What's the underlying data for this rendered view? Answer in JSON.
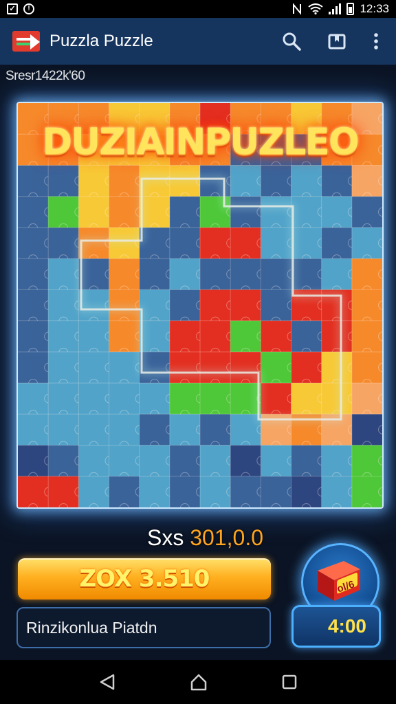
{
  "status_bar": {
    "time": "12:33",
    "left_icons": [
      "checkbox-icon",
      "info-circle-icon"
    ],
    "right_icons": [
      "nfc-icon",
      "wifi-icon",
      "signal-icon",
      "battery-icon"
    ]
  },
  "app_bar": {
    "title": "Puzzla Puzzle",
    "actions": [
      "search-icon",
      "bookmark-icon",
      "more-vert-icon"
    ]
  },
  "score_top": "Sresr1422k'60",
  "board": {
    "title": "DUZIAINPUZLEO",
    "colors": {
      "blue": "#1f5ea8",
      "light_blue": "#3aa7de",
      "red": "#e0231e",
      "green": "#36d13a",
      "orange": "#f58a2a",
      "yellow": "#f7d236",
      "navy": "#123d8a",
      "peach": "#f6a96a"
    }
  },
  "sxs": {
    "label": "Sxs",
    "value": "301,0.0"
  },
  "main_button": {
    "label": "ZOX 3.510"
  },
  "field": {
    "text": "Rinzikonlua Piatdn"
  },
  "badge": {
    "text": "ol/6",
    "icon": "crate-icon"
  },
  "timer": {
    "label": "4:00"
  },
  "nav": [
    "back-icon",
    "home-icon",
    "recents-icon"
  ],
  "accent_colors": {
    "app_bar": "#16355e",
    "button": "#ffb020",
    "timer_text": "#ffe14a",
    "score_orange": "#ffa51f"
  }
}
